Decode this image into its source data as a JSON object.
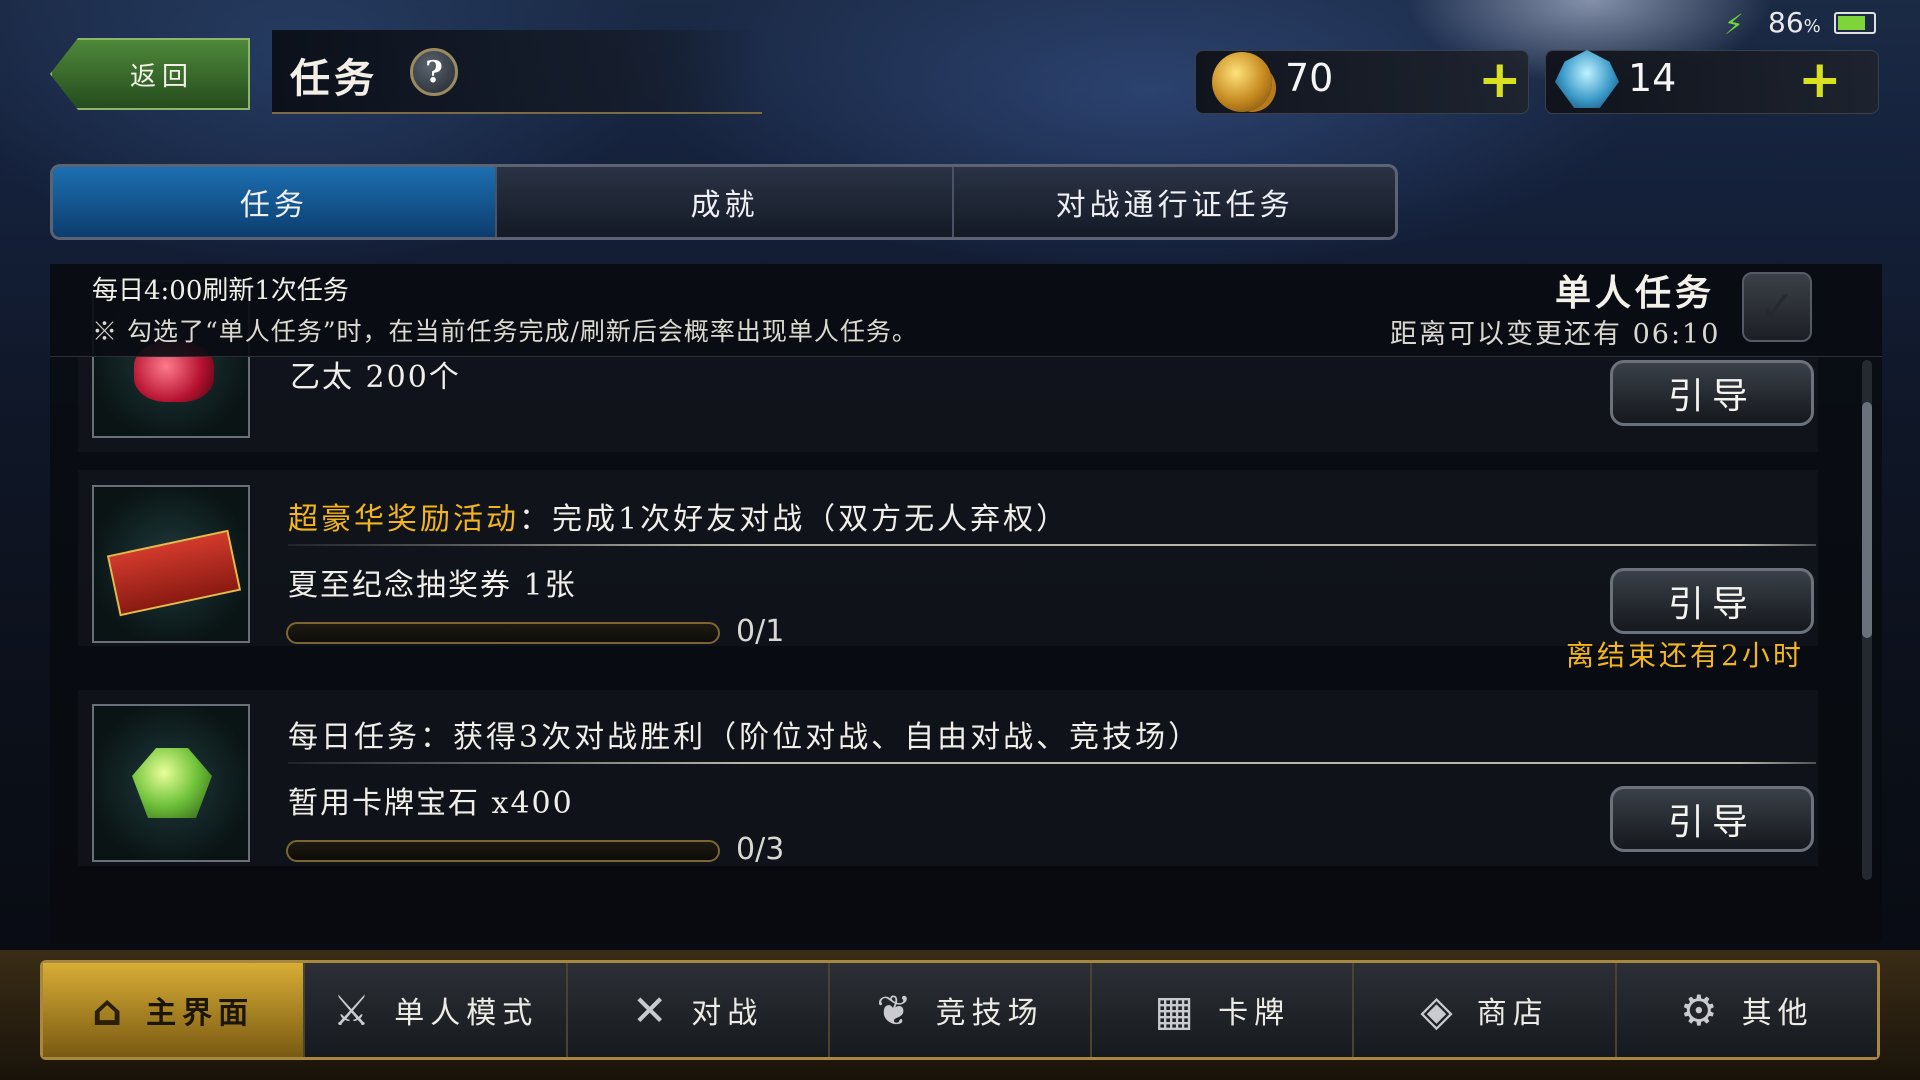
{
  "header": {
    "back_label": "返回",
    "title": "任务",
    "help_icon": "?"
  },
  "status": {
    "battery": "86",
    "battery_unit": "%"
  },
  "currency": {
    "gold": "70",
    "crystal": "14",
    "add": "+"
  },
  "tabs": [
    {
      "label": "任务",
      "active": true
    },
    {
      "label": "成就",
      "active": false
    },
    {
      "label": "对战通行证任务",
      "active": false
    }
  ],
  "info": {
    "refresh": "每日4:00刷新1次任务",
    "note": "※ 勾选了“单人任务”时，在当前任务完成/刷新后会概率出现单人任务。",
    "solo_title": "单人任务",
    "solo_sub": "距离可以变更还有 06:10",
    "solo_check": "✓"
  },
  "missions": [
    {
      "reward": "乙太 200个",
      "guide": "引导"
    },
    {
      "highlight": "超豪华奖励活动",
      "title": "：完成1次好友对战（双方无人弃权）",
      "reward": "夏至纪念抽奖券 1张",
      "progress_text": "0/1",
      "progress": 0,
      "guide": "引导",
      "time_left": "离结束还有2小时"
    },
    {
      "title": "每日任务：获得3次对战胜利（阶位对战、自由对战、竞技场）",
      "reward": "暂用卡牌宝石 x400",
      "progress_text": "0/3",
      "progress": 0,
      "guide": "引导"
    }
  ],
  "nav": [
    {
      "label": "主界面",
      "icon": "home-icon",
      "active": true
    },
    {
      "label": "单人模式",
      "icon": "sword-shield-icon",
      "active": false
    },
    {
      "label": "对战",
      "icon": "crossed-swords-icon",
      "active": false
    },
    {
      "label": "竞技场",
      "icon": "laurel-icon",
      "active": false
    },
    {
      "label": "卡牌",
      "icon": "cards-icon",
      "active": false
    },
    {
      "label": "商店",
      "icon": "shop-icon",
      "active": false
    },
    {
      "label": "其他",
      "icon": "gear-icon",
      "active": false
    }
  ],
  "colors": {
    "accent_gold": "#f2b51e",
    "tab_active": "#1d6fb1",
    "plus_yellow": "#d8e020",
    "back_green": "#4f8a3b"
  }
}
